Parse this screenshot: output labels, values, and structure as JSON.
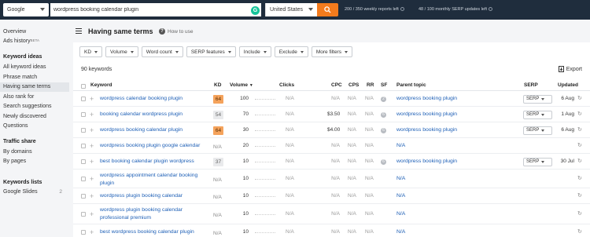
{
  "topbar": {
    "engine": "Google",
    "query": "wordpress booking calendar plugin",
    "country": "United States",
    "grammarly": "G",
    "reports_quota": "200 / 350 weekly reports left",
    "serp_quota": "48 / 100 monthly SERP updates left"
  },
  "sidebar": {
    "top_items": [
      {
        "label": "Overview"
      },
      {
        "label": "Ads history",
        "badge": "BETA"
      }
    ],
    "keyword_ideas_title": "Keyword ideas",
    "keyword_ideas": [
      "All keyword ideas",
      "Phrase match",
      "Having same terms",
      "Also rank for",
      "Search suggestions",
      "Newly discovered",
      "Questions"
    ],
    "traffic_share_title": "Traffic share",
    "traffic_share": [
      "By domains",
      "By pages"
    ],
    "keywords_lists_title": "Keywords lists",
    "lists": [
      {
        "label": "Google Slides",
        "count": "2"
      }
    ]
  },
  "main": {
    "title": "Having same terms",
    "how_to_use": "How to use",
    "filters": [
      "KD",
      "Volume",
      "Word count",
      "SERP features",
      "Include",
      "Exclude",
      "More filters"
    ],
    "keyword_count": "90 keywords",
    "export": "Export",
    "columns": {
      "keyword": "Keyword",
      "kd": "KD",
      "volume": "Volume",
      "volume_sort": "▼",
      "clicks": "Clicks",
      "cpc": "CPC",
      "cps": "CPS",
      "rr": "RR",
      "sf": "SF",
      "parent_topic": "Parent topic",
      "serp": "SERP",
      "updated": "Updated"
    },
    "rows": [
      {
        "keyword": "wordpress calendar booking plugin",
        "kd": "64",
        "kd_style": "orange",
        "volume": "100",
        "clicks": "N/A",
        "cpc": "N/A",
        "cps": "N/A",
        "rr": "N/A",
        "sf": "2",
        "parent": "wordpress booking plugin",
        "serp": "SERP",
        "updated": "6 Aug"
      },
      {
        "keyword": "booking calendar wordpress plugin",
        "kd": "54",
        "kd_style": "grey",
        "volume": "70",
        "clicks": "N/A",
        "cpc": "$3.50",
        "cps": "N/A",
        "rr": "N/A",
        "sf": "6",
        "parent": "wordpress booking plugin",
        "serp": "SERP",
        "updated": "1 Aug"
      },
      {
        "keyword": "wordpress booking calendar plugin",
        "kd": "64",
        "kd_style": "orange",
        "volume": "30",
        "clicks": "N/A",
        "cpc": "$4.00",
        "cps": "N/A",
        "rr": "N/A",
        "sf": "6",
        "parent": "wordpress booking plugin",
        "serp": "SERP",
        "updated": "6 Aug"
      },
      {
        "keyword": "wordpress booking plugin google calendar",
        "kd": "N/A",
        "kd_style": "plain",
        "volume": "20",
        "clicks": "N/A",
        "cpc": "N/A",
        "cps": "N/A",
        "rr": "N/A",
        "sf": "",
        "parent": "N/A",
        "serp": "",
        "updated": ""
      },
      {
        "keyword": "best booking calendar plugin wordpress",
        "kd": "37",
        "kd_style": "grey",
        "volume": "10",
        "clicks": "N/A",
        "cpc": "N/A",
        "cps": "N/A",
        "rr": "N/A",
        "sf": "6",
        "parent": "wordpress booking plugin",
        "serp": "SERP",
        "updated": "30 Jul"
      },
      {
        "keyword": "wordpress appointment calendar booking plugin",
        "kd": "N/A",
        "kd_style": "plain",
        "volume": "10",
        "clicks": "N/A",
        "cpc": "N/A",
        "cps": "N/A",
        "rr": "N/A",
        "sf": "",
        "parent": "N/A",
        "serp": "",
        "updated": ""
      },
      {
        "keyword": "wordpress plugin booking calendar",
        "kd": "N/A",
        "kd_style": "plain",
        "volume": "10",
        "clicks": "N/A",
        "cpc": "N/A",
        "cps": "N/A",
        "rr": "N/A",
        "sf": "",
        "parent": "N/A",
        "serp": "",
        "updated": ""
      },
      {
        "keyword": "wordpress plugin booking calendar professional premium",
        "kd": "N/A",
        "kd_style": "plain",
        "volume": "10",
        "clicks": "N/A",
        "cpc": "N/A",
        "cps": "N/A",
        "rr": "N/A",
        "sf": "",
        "parent": "N/A",
        "serp": "",
        "updated": ""
      },
      {
        "keyword": "best wordpress booking calendar plugin",
        "kd": "N/A",
        "kd_style": "plain",
        "volume": "10",
        "clicks": "N/A",
        "cpc": "N/A",
        "cps": "N/A",
        "rr": "N/A",
        "sf": "",
        "parent": "N/A",
        "serp": "",
        "updated": ""
      }
    ]
  }
}
